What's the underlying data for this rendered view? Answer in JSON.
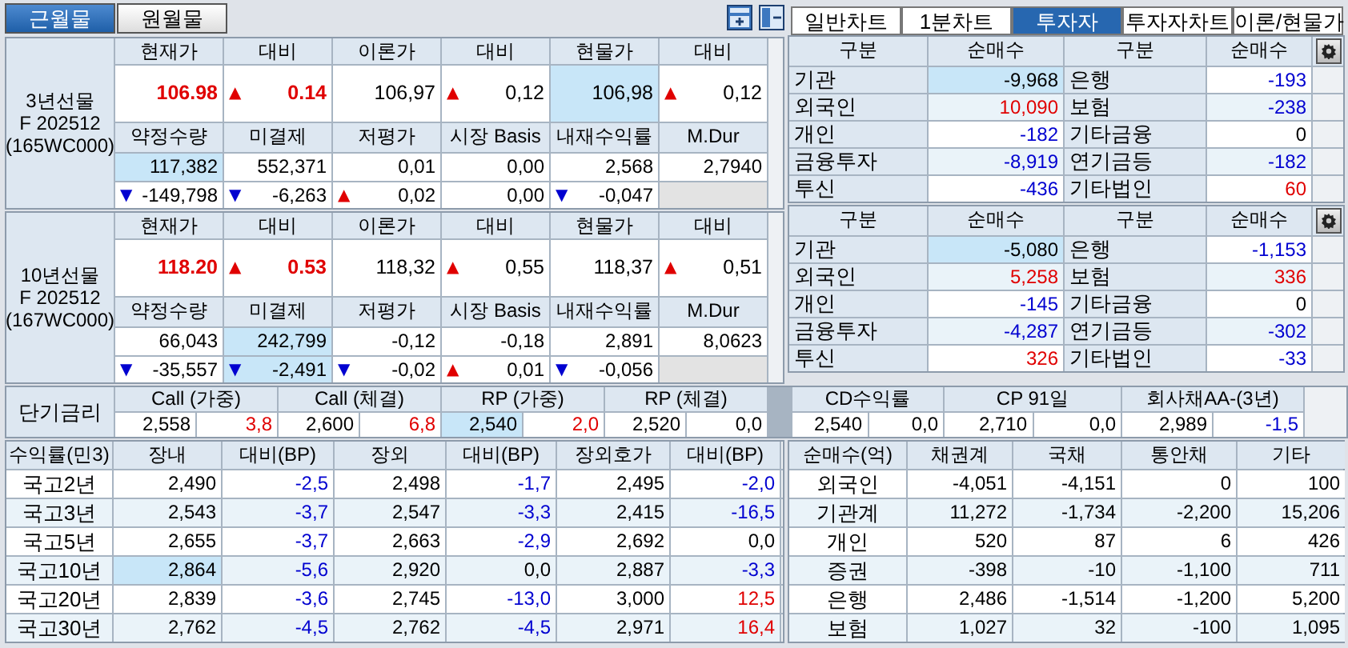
{
  "contract_tabs": [
    {
      "label": "근월물",
      "selected": true
    },
    {
      "label": "원월물",
      "selected": false
    }
  ],
  "futures": [
    {
      "name_lines": [
        "3년선물",
        "F 202512",
        "(165WC000)"
      ],
      "top_headers": [
        "현재가",
        "대비",
        "이론가",
        "대비",
        "현물가",
        "대비"
      ],
      "top_values": [
        {
          "value": "106.98",
          "color": "#e00000",
          "highlighted": false
        },
        {
          "arrow": {
            "symbol": "▲",
            "color": "#e00000"
          },
          "value": "0.14",
          "color": "#e00000",
          "highlighted": false
        },
        {
          "value": "106,97",
          "color": "#000000",
          "highlighted": false
        },
        {
          "arrow": {
            "symbol": "▲",
            "color": "#e00000"
          },
          "value": "0,12",
          "color": "#000000",
          "highlighted": false
        },
        {
          "value": "106,98",
          "color": "#000000",
          "highlighted": true
        },
        {
          "arrow": {
            "symbol": "▲",
            "color": "#e00000"
          },
          "value": "0,12",
          "color": "#000000",
          "highlighted": false
        }
      ],
      "bottom_headers": [
        "약정수량",
        "미결제",
        "저평가",
        "시장 Basis",
        "내재수익률",
        "M.Dur"
      ],
      "bottom_values": [
        {
          "value": "117,382",
          "highlighted": true
        },
        {
          "value": "552,371",
          "highlighted": false
        },
        {
          "value": "0,01",
          "highlighted": false
        },
        {
          "value": "0,00",
          "highlighted": false
        },
        {
          "value": "2,568",
          "highlighted": false
        },
        {
          "value": "2,7940",
          "highlighted": false
        }
      ],
      "changes": [
        {
          "arrow": {
            "symbol": "▼",
            "color": "#0000d0"
          },
          "value": "-149,798",
          "highlighted": false
        },
        {
          "arrow": {
            "symbol": "▼",
            "color": "#0000d0"
          },
          "value": "-6,263",
          "highlighted": false
        },
        {
          "arrow": {
            "symbol": "▲",
            "color": "#e00000"
          },
          "value": "0,02",
          "highlighted": false
        },
        {
          "value": "0,00",
          "highlighted": false
        },
        {
          "arrow": {
            "symbol": "▼",
            "color": "#0000d0"
          },
          "value": "-0,047",
          "highlighted": false
        }
      ]
    },
    {
      "name_lines": [
        "10년선물",
        "F 202512",
        "(167WC000)"
      ],
      "top_headers": [
        "현재가",
        "대비",
        "이론가",
        "대비",
        "현물가",
        "대비"
      ],
      "top_values": [
        {
          "value": "118.20",
          "color": "#e00000",
          "highlighted": false
        },
        {
          "arrow": {
            "symbol": "▲",
            "color": "#e00000"
          },
          "value": "0.53",
          "color": "#e00000",
          "highlighted": false
        },
        {
          "value": "118,32",
          "color": "#000000",
          "highlighted": false
        },
        {
          "arrow": {
            "symbol": "▲",
            "color": "#e00000"
          },
          "value": "0,55",
          "color": "#000000",
          "highlighted": false
        },
        {
          "value": "118,37",
          "color": "#000000",
          "highlighted": false
        },
        {
          "arrow": {
            "symbol": "▲",
            "color": "#e00000"
          },
          "value": "0,51",
          "color": "#000000",
          "highlighted": false
        }
      ],
      "bottom_headers": [
        "약정수량",
        "미결제",
        "저평가",
        "시장 Basis",
        "내재수익률",
        "M.Dur"
      ],
      "bottom_values": [
        {
          "value": "66,043",
          "highlighted": false
        },
        {
          "value": "242,799",
          "highlighted": true
        },
        {
          "value": "-0,12",
          "highlighted": false
        },
        {
          "value": "-0,18",
          "highlighted": false
        },
        {
          "value": "2,891",
          "highlighted": false
        },
        {
          "value": "8,0623",
          "highlighted": false
        }
      ],
      "changes": [
        {
          "arrow": {
            "symbol": "▼",
            "color": "#0000d0"
          },
          "value": "-35,557",
          "highlighted": false
        },
        {
          "arrow": {
            "symbol": "▼",
            "color": "#0000d0"
          },
          "value": "-2,491",
          "highlighted": true
        },
        {
          "arrow": {
            "symbol": "▼",
            "color": "#0000d0"
          },
          "value": "-0,02",
          "highlighted": false
        },
        {
          "arrow": {
            "symbol": "▲",
            "color": "#e00000"
          },
          "value": "0,01",
          "highlighted": false
        },
        {
          "arrow": {
            "symbol": "▼",
            "color": "#0000d0"
          },
          "value": "-0,056",
          "highlighted": false
        }
      ]
    }
  ],
  "view_tabs": [
    {
      "label": "일반차트",
      "selected": false
    },
    {
      "label": "1분차트",
      "selected": false
    },
    {
      "label": "투자자",
      "selected": true
    },
    {
      "label": "투자자차트",
      "selected": false
    },
    {
      "label": "이론/현물가",
      "selected": false
    }
  ],
  "investor_tables": [
    {
      "headers": [
        "구분",
        "순매수",
        "구분",
        "순매수"
      ],
      "rows": [
        {
          "pairs": [
            {
              "label": "기관",
              "value": "-9,968",
              "color": "#000000",
              "highlighted": true
            },
            {
              "label": "은행",
              "value": "-193",
              "color": "#0000d0",
              "highlighted": false
            }
          ]
        },
        {
          "pairs": [
            {
              "label": "외국인",
              "value": "10,090",
              "color": "#e00000",
              "highlighted": false
            },
            {
              "label": "보험",
              "value": "-238",
              "color": "#0000d0",
              "highlighted": false
            }
          ]
        },
        {
          "pairs": [
            {
              "label": "개인",
              "value": "-182",
              "color": "#0000d0",
              "highlighted": false
            },
            {
              "label": "기타금융",
              "value": "0",
              "color": "#000000",
              "highlighted": false
            }
          ]
        },
        {
          "pairs": [
            {
              "label": "금융투자",
              "value": "-8,919",
              "color": "#0000d0",
              "highlighted": false
            },
            {
              "label": "연기금등",
              "value": "-182",
              "color": "#0000d0",
              "highlighted": false
            }
          ]
        },
        {
          "pairs": [
            {
              "label": "투신",
              "value": "-436",
              "color": "#0000d0",
              "highlighted": false
            },
            {
              "label": "기타법인",
              "value": "60",
              "color": "#e00000",
              "highlighted": false
            }
          ]
        }
      ]
    },
    {
      "headers": [
        "구분",
        "순매수",
        "구분",
        "순매수"
      ],
      "rows": [
        {
          "pairs": [
            {
              "label": "기관",
              "value": "-5,080",
              "color": "#000000",
              "highlighted": true
            },
            {
              "label": "은행",
              "value": "-1,153",
              "color": "#0000d0",
              "highlighted": false
            }
          ]
        },
        {
          "pairs": [
            {
              "label": "외국인",
              "value": "5,258",
              "color": "#e00000",
              "highlighted": false
            },
            {
              "label": "보험",
              "value": "336",
              "color": "#e00000",
              "highlighted": false
            }
          ]
        },
        {
          "pairs": [
            {
              "label": "개인",
              "value": "-145",
              "color": "#0000d0",
              "highlighted": false
            },
            {
              "label": "기타금융",
              "value": "0",
              "color": "#000000",
              "highlighted": false
            }
          ]
        },
        {
          "pairs": [
            {
              "label": "금융투자",
              "value": "-4,287",
              "color": "#0000d0",
              "highlighted": false
            },
            {
              "label": "연기금등",
              "value": "-302",
              "color": "#0000d0",
              "highlighted": false
            }
          ]
        },
        {
          "pairs": [
            {
              "label": "투신",
              "value": "326",
              "color": "#e00000",
              "highlighted": false
            },
            {
              "label": "기타법인",
              "value": "-33",
              "color": "#0000d0",
              "highlighted": false
            }
          ]
        }
      ]
    }
  ],
  "short_rates": {
    "label": "단기금리",
    "groups": [
      {
        "label": "Call (가중)",
        "value": "2,558",
        "change": "3,8",
        "color": "#e00000",
        "highlighted": false
      },
      {
        "label": "Call (체결)",
        "value": "2,600",
        "change": "6,8",
        "color": "#e00000",
        "highlighted": false
      },
      {
        "label": "RP (가중)",
        "value": "2,540",
        "change": "2,0",
        "color": "#e00000",
        "highlighted": true
      },
      {
        "label": "RP (체결)",
        "value": "2,520",
        "change": "0,0",
        "color": "#000000",
        "highlighted": false
      },
      {
        "label": "CD수익률",
        "value": "2,540",
        "change": "0,0",
        "color": "#000000",
        "highlighted": false
      },
      {
        "label": "CP 91일",
        "value": "2,710",
        "change": "0,0",
        "color": "#000000",
        "highlighted": false
      },
      {
        "label": "회사채AA-(3년)",
        "value": "2,989",
        "change": "-1,5",
        "color": "#0000d0",
        "highlighted": false
      }
    ]
  },
  "yields": {
    "corner": "수익률(민3)",
    "columns": [
      "장내",
      "대비(BP)",
      "장외",
      "대비(BP)",
      "장외호가",
      "대비(BP)"
    ],
    "rows": [
      {
        "label": "국고2년",
        "cells": [
          {
            "value": "2,490",
            "color": "#000000",
            "highlighted": false
          },
          {
            "value": "-2,5",
            "color": "#0000d0",
            "highlighted": false
          },
          {
            "value": "2,498",
            "color": "#000000",
            "highlighted": false
          },
          {
            "value": "-1,7",
            "color": "#0000d0",
            "highlighted": false
          },
          {
            "value": "2,495",
            "color": "#000000",
            "highlighted": false
          },
          {
            "value": "-2,0",
            "color": "#0000d0",
            "highlighted": false
          }
        ]
      },
      {
        "label": "국고3년",
        "cells": [
          {
            "value": "2,543",
            "color": "#000000",
            "highlighted": false
          },
          {
            "value": "-3,7",
            "color": "#0000d0",
            "highlighted": false
          },
          {
            "value": "2,547",
            "color": "#000000",
            "highlighted": false
          },
          {
            "value": "-3,3",
            "color": "#0000d0",
            "highlighted": false
          },
          {
            "value": "2,415",
            "color": "#000000",
            "highlighted": false
          },
          {
            "value": "-16,5",
            "color": "#0000d0",
            "highlighted": false
          }
        ]
      },
      {
        "label": "국고5년",
        "cells": [
          {
            "value": "2,655",
            "color": "#000000",
            "highlighted": false
          },
          {
            "value": "-3,7",
            "color": "#0000d0",
            "highlighted": false
          },
          {
            "value": "2,663",
            "color": "#000000",
            "highlighted": false
          },
          {
            "value": "-2,9",
            "color": "#0000d0",
            "highlighted": false
          },
          {
            "value": "2,692",
            "color": "#000000",
            "highlighted": false
          },
          {
            "value": "0,0",
            "color": "#000000",
            "highlighted": false
          }
        ]
      },
      {
        "label": "국고10년",
        "cells": [
          {
            "value": "2,864",
            "color": "#000000",
            "highlighted": true
          },
          {
            "value": "-5,6",
            "color": "#0000d0",
            "highlighted": false
          },
          {
            "value": "2,920",
            "color": "#000000",
            "highlighted": false
          },
          {
            "value": "0,0",
            "color": "#000000",
            "highlighted": false
          },
          {
            "value": "2,887",
            "color": "#000000",
            "highlighted": false
          },
          {
            "value": "-3,3",
            "color": "#0000d0",
            "highlighted": false
          }
        ]
      },
      {
        "label": "국고20년",
        "cells": [
          {
            "value": "2,839",
            "color": "#000000",
            "highlighted": false
          },
          {
            "value": "-3,6",
            "color": "#0000d0",
            "highlighted": false
          },
          {
            "value": "2,745",
            "color": "#000000",
            "highlighted": false
          },
          {
            "value": "-13,0",
            "color": "#0000d0",
            "highlighted": false
          },
          {
            "value": "3,000",
            "color": "#000000",
            "highlighted": false
          },
          {
            "value": "12,5",
            "color": "#e00000",
            "highlighted": false
          }
        ]
      },
      {
        "label": "국고30년",
        "cells": [
          {
            "value": "2,762",
            "color": "#000000",
            "highlighted": false
          },
          {
            "value": "-4,5",
            "color": "#0000d0",
            "highlighted": false
          },
          {
            "value": "2,762",
            "color": "#000000",
            "highlighted": false
          },
          {
            "value": "-4,5",
            "color": "#0000d0",
            "highlighted": false
          },
          {
            "value": "2,971",
            "color": "#000000",
            "highlighted": false
          },
          {
            "value": "16,4",
            "color": "#e00000",
            "highlighted": false
          }
        ]
      }
    ]
  },
  "net_purchases": {
    "corner": "순매수(억)",
    "columns": [
      "채권계",
      "국채",
      "통안채",
      "기타"
    ],
    "rows": [
      {
        "label": "외국인",
        "values": [
          "-4,051",
          "-4,151",
          "0",
          "100"
        ]
      },
      {
        "label": "기관계",
        "values": [
          "11,272",
          "-1,734",
          "-2,200",
          "15,206"
        ]
      },
      {
        "label": "개인",
        "values": [
          "520",
          "87",
          "6",
          "426"
        ]
      },
      {
        "label": "증권",
        "values": [
          "-398",
          "-10",
          "-1,100",
          "711"
        ]
      },
      {
        "label": "은행",
        "values": [
          "2,486",
          "-1,514",
          "-1,200",
          "5,200"
        ]
      },
      {
        "label": "보험",
        "values": [
          "1,027",
          "32",
          "-100",
          "1,095"
        ]
      }
    ]
  }
}
